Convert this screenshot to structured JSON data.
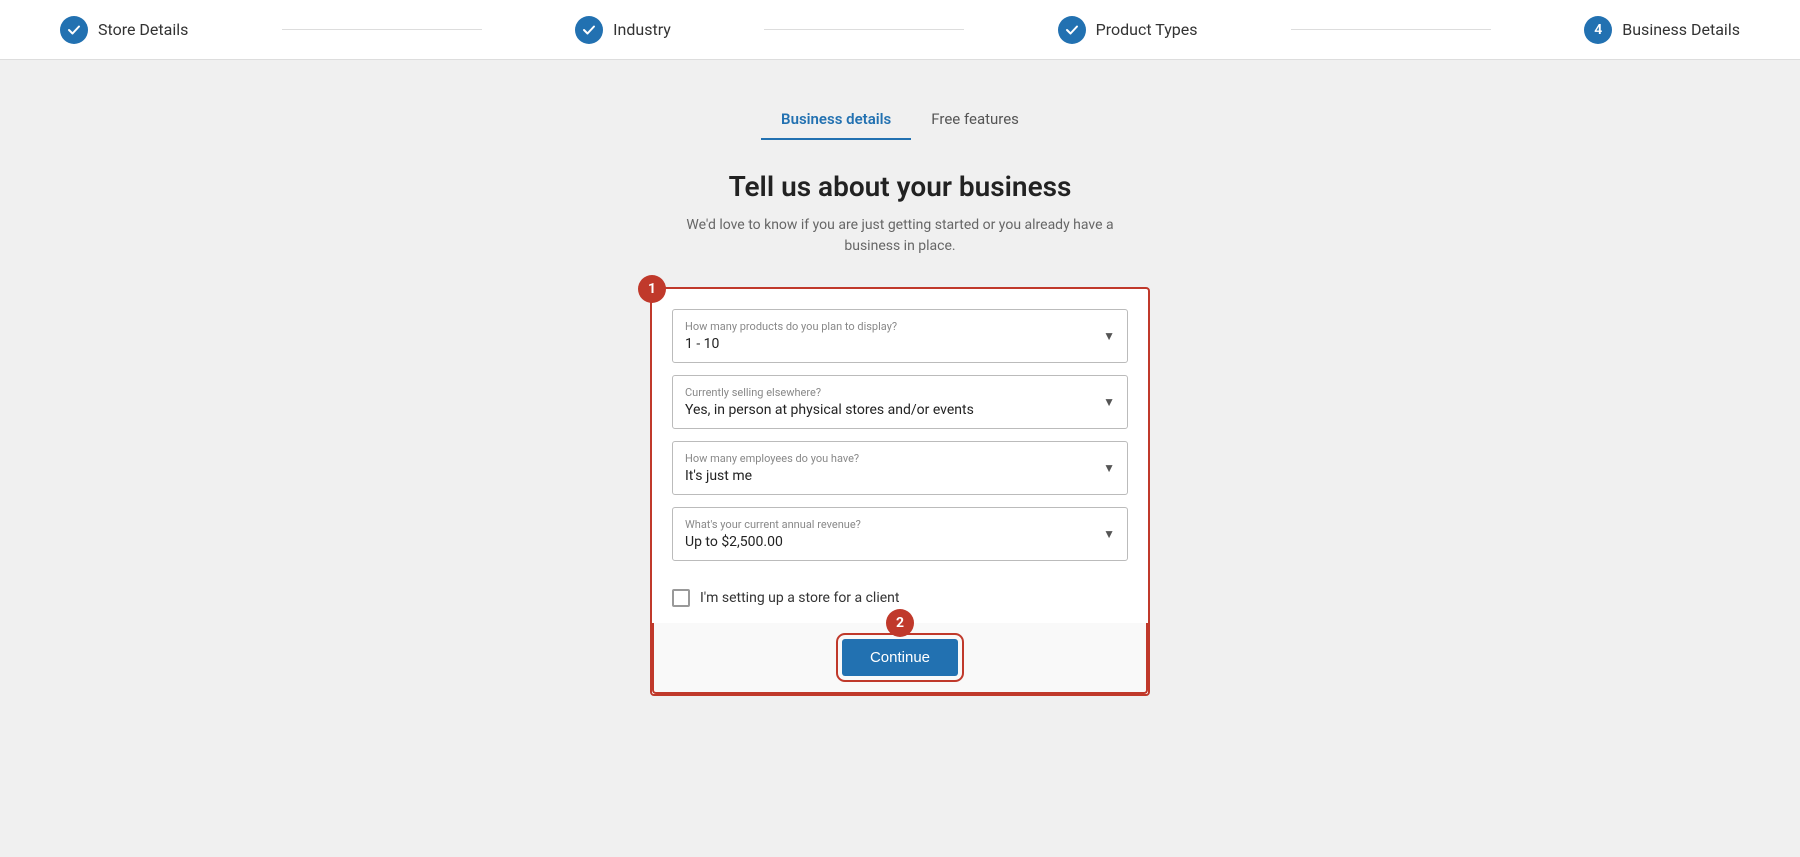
{
  "stepper": {
    "steps": [
      {
        "id": "store-details",
        "label": "Store Details",
        "type": "check"
      },
      {
        "id": "industry",
        "label": "Industry",
        "type": "check"
      },
      {
        "id": "product-types",
        "label": "Product Types",
        "type": "check"
      },
      {
        "id": "business-details",
        "label": "Business Details",
        "type": "number",
        "number": "4"
      }
    ]
  },
  "tabs": [
    {
      "id": "business-details",
      "label": "Business details",
      "active": true
    },
    {
      "id": "free-features",
      "label": "Free features",
      "active": false
    }
  ],
  "heading": "Tell us about your business",
  "subheading": "We'd love to know if you are just getting started or you already have a business in place.",
  "form": {
    "badge": "1",
    "fields": [
      {
        "id": "num-products",
        "label": "How many products do you plan to display?",
        "value": "1 - 10"
      },
      {
        "id": "selling-elsewhere",
        "label": "Currently selling elsewhere?",
        "value": "Yes, in person at physical stores and/or events"
      },
      {
        "id": "num-employees",
        "label": "How many employees do you have?",
        "value": "It's just me"
      },
      {
        "id": "annual-revenue",
        "label": "What's your current annual revenue?",
        "value": "Up to $2,500.00"
      }
    ],
    "checkbox": {
      "id": "client-store",
      "label": "I'm setting up a store for a client",
      "checked": false
    }
  },
  "continue_section": {
    "badge": "2",
    "button_label": "Continue"
  }
}
